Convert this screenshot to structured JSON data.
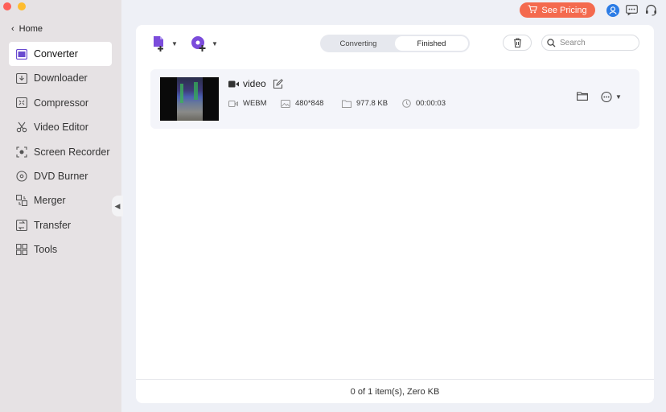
{
  "window": {
    "controls": [
      {
        "name": "close",
        "color": "#fe5f57"
      },
      {
        "name": "minimize",
        "color": "#febc2e"
      }
    ]
  },
  "sidebar": {
    "home_label": "Home",
    "items": [
      {
        "label": "Converter",
        "icon": "converter-icon",
        "active": true
      },
      {
        "label": "Downloader",
        "icon": "downloader-icon"
      },
      {
        "label": "Compressor",
        "icon": "compressor-icon"
      },
      {
        "label": "Video Editor",
        "icon": "scissors-icon"
      },
      {
        "label": "Screen Recorder",
        "icon": "screen-recorder-icon"
      },
      {
        "label": "DVD Burner",
        "icon": "dvd-icon"
      },
      {
        "label": "Merger",
        "icon": "merger-icon"
      },
      {
        "label": "Transfer",
        "icon": "transfer-icon"
      },
      {
        "label": "Tools",
        "icon": "tools-icon"
      }
    ]
  },
  "topbar": {
    "pricing_label": "See Pricing"
  },
  "toolbar": {
    "tabs": [
      {
        "label": "Converting",
        "active": false
      },
      {
        "label": "Finished",
        "active": true
      }
    ],
    "search_placeholder": "Search"
  },
  "file": {
    "name": "video",
    "format": "WEBM",
    "resolution": "480*848",
    "size": "977.8 KB",
    "duration": "00:00:03"
  },
  "footer": {
    "status": "0 of 1 item(s), Zero KB"
  },
  "colors": {
    "accent": "#7b4cdb",
    "pricing": "#f46a4e",
    "avatar": "#2b7be5"
  }
}
